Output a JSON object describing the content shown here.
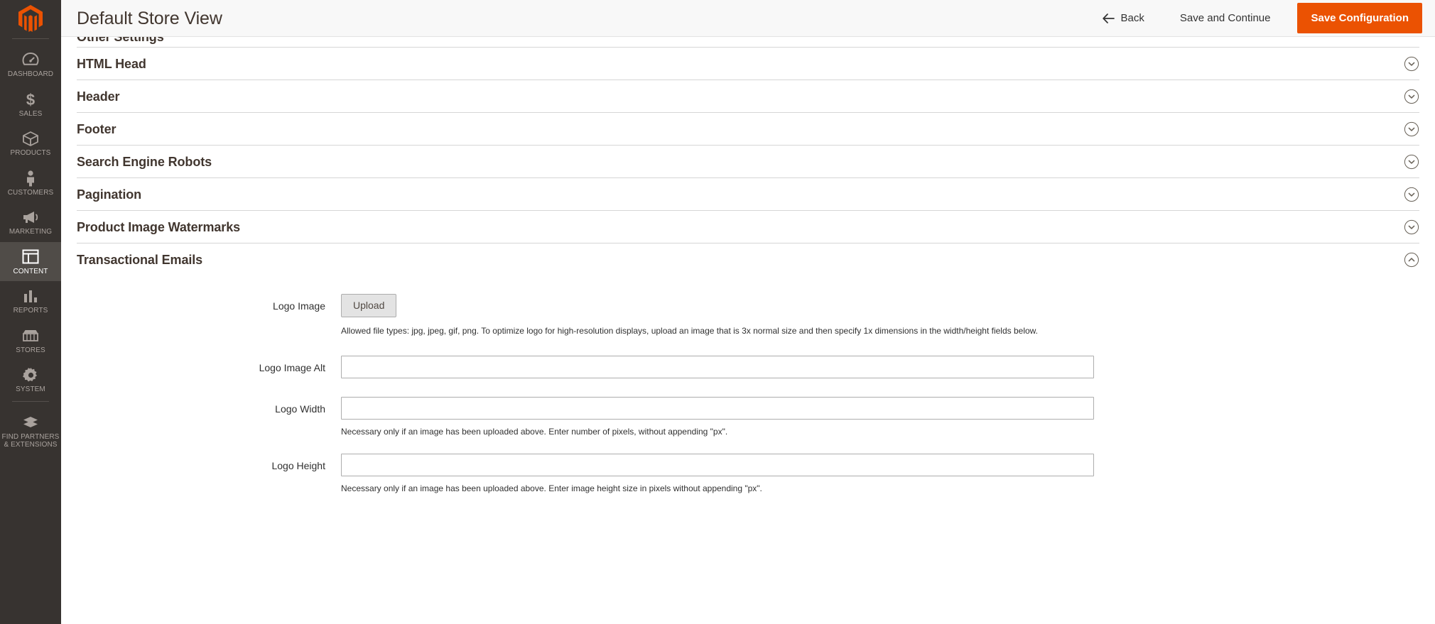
{
  "brand": {
    "accent": "#eb5202",
    "sidebar_bg": "#373330",
    "header_bg": "#f8f8f8"
  },
  "sidebar": {
    "logo_name": "magento-logo",
    "items": [
      {
        "label": "DASHBOARD",
        "icon": "dashboard-icon",
        "active": false
      },
      {
        "label": "SALES",
        "icon": "sales-icon",
        "active": false
      },
      {
        "label": "PRODUCTS",
        "icon": "products-icon",
        "active": false
      },
      {
        "label": "CUSTOMERS",
        "icon": "customers-icon",
        "active": false
      },
      {
        "label": "MARKETING",
        "icon": "marketing-icon",
        "active": false
      },
      {
        "label": "CONTENT",
        "icon": "content-icon",
        "active": true
      },
      {
        "label": "REPORTS",
        "icon": "reports-icon",
        "active": false
      },
      {
        "label": "STORES",
        "icon": "stores-icon",
        "active": false
      },
      {
        "label": "SYSTEM",
        "icon": "system-icon",
        "active": false
      },
      {
        "label": "FIND PARTNERS\n& EXTENSIONS",
        "icon": "find-partners-icon",
        "active": false
      }
    ]
  },
  "header": {
    "title": "Default Store View",
    "back_label": "Back",
    "save_continue_label": "Save and Continue",
    "save_config_label": "Save Configuration"
  },
  "sections": [
    {
      "title": "Other Settings",
      "state": "collapsed",
      "icon": "chevron-down-icon",
      "clipped": true
    },
    {
      "title": "HTML Head",
      "state": "collapsed",
      "icon": "chevron-down-icon"
    },
    {
      "title": "Header",
      "state": "collapsed",
      "icon": "chevron-down-icon"
    },
    {
      "title": "Footer",
      "state": "collapsed",
      "icon": "chevron-down-icon"
    },
    {
      "title": "Search Engine Robots",
      "state": "collapsed",
      "icon": "chevron-down-icon"
    },
    {
      "title": "Pagination",
      "state": "collapsed",
      "icon": "chevron-down-icon"
    },
    {
      "title": "Product Image Watermarks",
      "state": "collapsed",
      "icon": "chevron-down-icon"
    },
    {
      "title": "Transactional Emails",
      "state": "expanded",
      "icon": "chevron-up-icon"
    }
  ],
  "transactional_emails": {
    "logo_image": {
      "label": "Logo Image",
      "upload_label": "Upload",
      "note": "Allowed file types: jpg, jpeg, gif, png. To optimize logo for high-resolution displays, upload an image that is 3x normal size and then specify 1x dimensions in the width/height fields below."
    },
    "logo_image_alt": {
      "label": "Logo Image Alt",
      "value": "",
      "placeholder": ""
    },
    "logo_width": {
      "label": "Logo Width",
      "value": "",
      "placeholder": "",
      "note": "Necessary only if an image has been uploaded above. Enter number of pixels, without appending \"px\"."
    },
    "logo_height": {
      "label": "Logo Height",
      "value": "",
      "placeholder": "",
      "note": "Necessary only if an image has been uploaded above. Enter image height size in pixels without appending \"px\"."
    }
  }
}
